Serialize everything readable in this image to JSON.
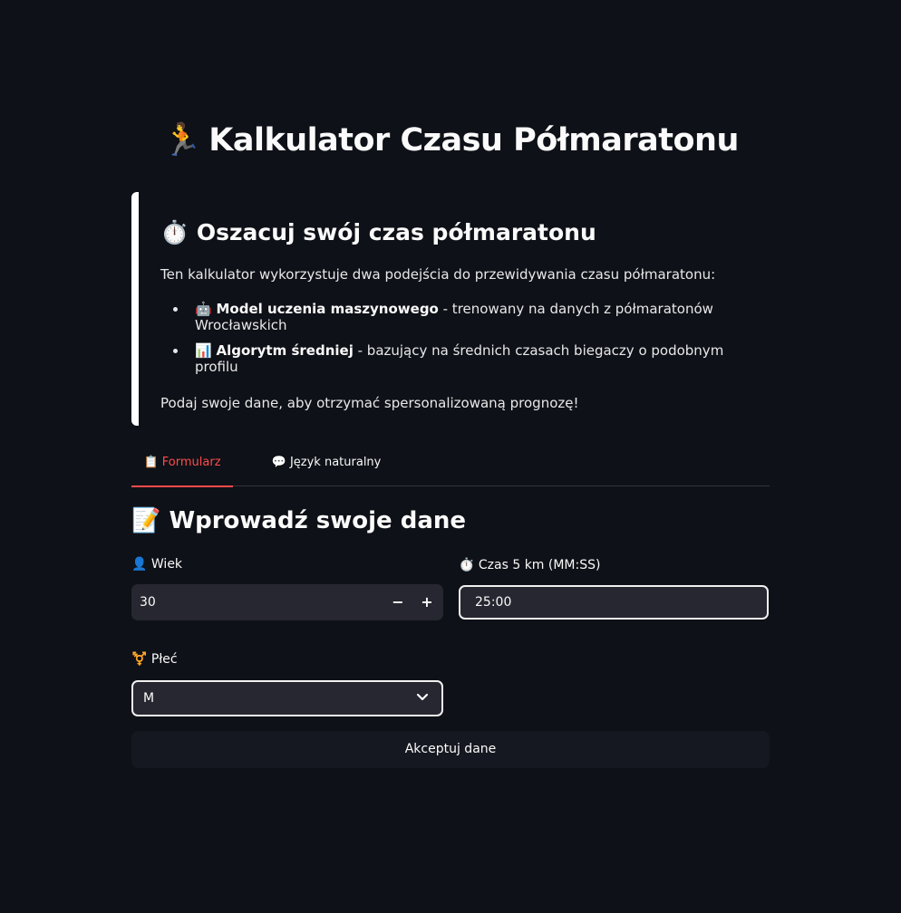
{
  "header": {
    "icon": "🏃",
    "title": "Kalkulator Czasu Półmaratonu"
  },
  "info": {
    "heading_icon": "⏱️",
    "heading": "Oszacuj swój czas półmaratonu",
    "intro": "Ten kalkulator wykorzystuje dwa podejścia do przewidywania czasu półmaratonu:",
    "items": [
      {
        "icon": "🤖",
        "bold": "Model uczenia maszynowego",
        "text": " - trenowany na danych z półmaratonów Wrocławskich"
      },
      {
        "icon": "📊",
        "bold": "Algorytm średniej",
        "text": " - bazujący na średnich czasach biegaczy o podobnym profilu"
      }
    ],
    "outro": "Podaj swoje dane, aby otrzymać spersonalizowaną prognozę!"
  },
  "tabs": [
    {
      "icon": "📋",
      "label": "Formularz",
      "active": true
    },
    {
      "icon": "💬",
      "label": "Język naturalny",
      "active": false
    }
  ],
  "form": {
    "title_icon": "📝",
    "title": "Wprowadź swoje dane",
    "age": {
      "icon": "👤",
      "label": "Wiek",
      "value": "30",
      "minus": "−",
      "plus": "+"
    },
    "time5k": {
      "icon": "⏱️",
      "label": "Czas 5 km (MM:SS)",
      "value": "25:00"
    },
    "gender": {
      "icon": "⚧️",
      "label": "Płeć",
      "value": "M"
    },
    "submit_label": "Akceptuj dane"
  },
  "colors": {
    "background": "#0e1117",
    "accent": "#ff4b4b",
    "input_bg": "#262730"
  }
}
